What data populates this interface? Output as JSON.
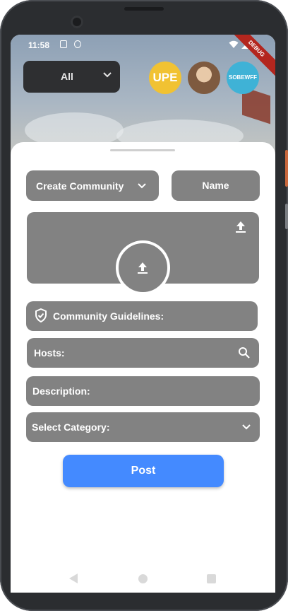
{
  "status_bar": {
    "time": "11:58",
    "debug_banner": "DEBUG"
  },
  "top_bar": {
    "filter_value": "All"
  },
  "stories": [
    {
      "name": "upe",
      "label": "UPE"
    },
    {
      "name": "portrait",
      "label": ""
    },
    {
      "name": "brand",
      "label": "SOBEWFF"
    }
  ],
  "form": {
    "community_type": "Create Community",
    "name_placeholder": "Name",
    "guidelines_label": "Community Guidelines:",
    "hosts_label": "Hosts:",
    "description_label": "Description:",
    "category_label": "Select Category:",
    "post_button": "Post"
  },
  "colors": {
    "field_bg": "#828282",
    "primary": "#448aff",
    "filter_bg": "#2e2f31"
  },
  "icons": {
    "upload": "upload-icon",
    "shield": "shield-check-icon",
    "search": "search-icon",
    "chevron": "chevron-down-icon"
  }
}
